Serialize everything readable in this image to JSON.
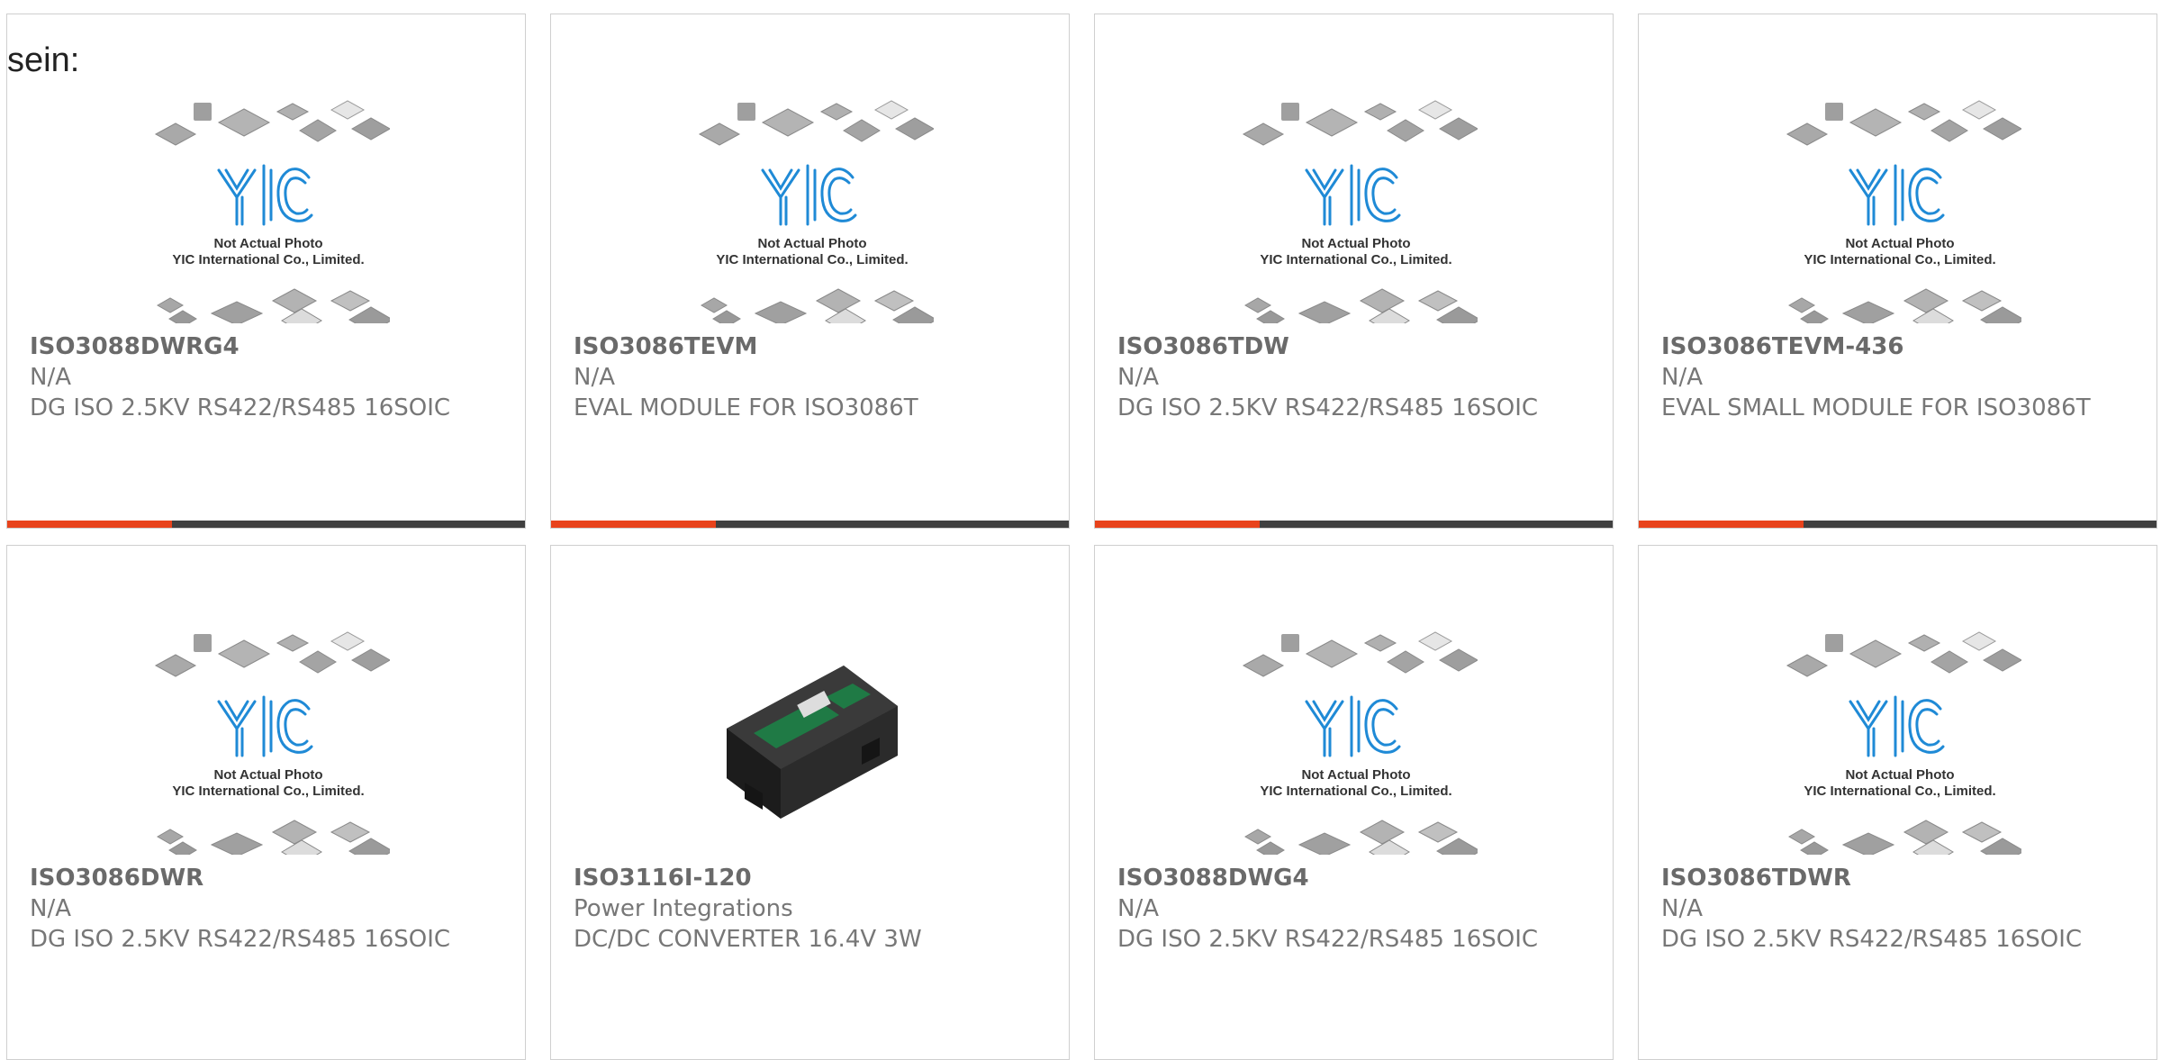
{
  "header": {
    "text": "sein:"
  },
  "placeholder": {
    "line1": "Not Actual Photo",
    "line2": "YIC International Co., Limited.",
    "logo_text": "YIC"
  },
  "colors": {
    "accent": "#e8431c",
    "bar": "#404040",
    "logo_blue": "#1f8ad6"
  },
  "products": [
    {
      "part": "ISO3088DWRG4",
      "maker": "N/A",
      "desc": "DG ISO 2.5KV RS422/RS485 16SOIC",
      "image": "placeholder",
      "show_bar": true
    },
    {
      "part": "ISO3086TEVM",
      "maker": "N/A",
      "desc": "EVAL MODULE FOR ISO3086T",
      "image": "placeholder",
      "show_bar": true
    },
    {
      "part": "ISO3086TDW",
      "maker": "N/A",
      "desc": "DG ISO 2.5KV RS422/RS485 16SOIC",
      "image": "placeholder",
      "show_bar": true
    },
    {
      "part": "ISO3086TEVM-436",
      "maker": "N/A",
      "desc": "EVAL SMALL MODULE FOR ISO3086T",
      "image": "placeholder",
      "show_bar": true
    },
    {
      "part": "ISO3086DWR",
      "maker": "N/A",
      "desc": "DG ISO 2.5KV RS422/RS485 16SOIC",
      "image": "placeholder",
      "show_bar": false
    },
    {
      "part": "ISO3116I-120",
      "maker": "Power Integrations",
      "desc": "DC/DC CONVERTER 16.4V 3W",
      "image": "converter-photo",
      "show_bar": false
    },
    {
      "part": "ISO3088DWG4",
      "maker": "N/A",
      "desc": "DG ISO 2.5KV RS422/RS485 16SOIC",
      "image": "placeholder",
      "show_bar": false
    },
    {
      "part": "ISO3086TDWR",
      "maker": "N/A",
      "desc": "DG ISO 2.5KV RS422/RS485 16SOIC",
      "image": "placeholder",
      "show_bar": false
    }
  ]
}
